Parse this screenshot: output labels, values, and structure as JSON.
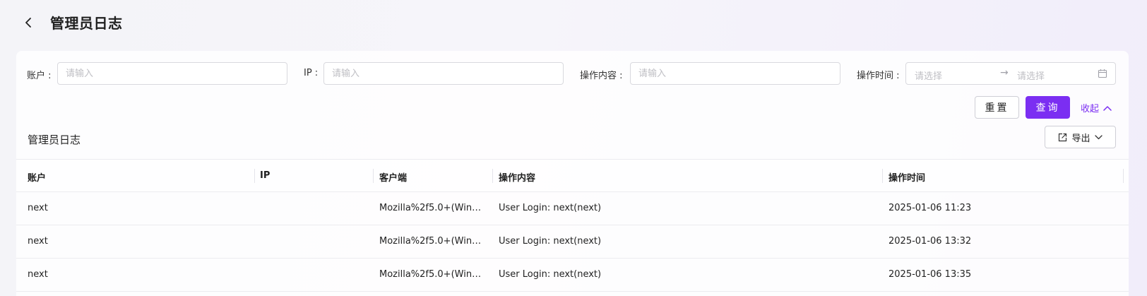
{
  "header": {
    "title": "管理员日志"
  },
  "filters": {
    "account": {
      "label": "账户 :",
      "placeholder": "请输入",
      "value": ""
    },
    "ip": {
      "label": "IP :",
      "placeholder": "请输入",
      "value": ""
    },
    "content": {
      "label": "操作内容 :",
      "placeholder": "请输入",
      "value": ""
    },
    "time": {
      "label": "操作时间 :",
      "start_placeholder": "请选择",
      "end_placeholder": "请选择",
      "arrow": "→"
    }
  },
  "actions": {
    "reset": "重置",
    "query": "查询",
    "collapse": "收起"
  },
  "section": {
    "title": "管理员日志",
    "export": "导出"
  },
  "table": {
    "columns": [
      "账户",
      "IP",
      "客户端",
      "操作内容",
      "操作时间"
    ],
    "rows": [
      {
        "account": "next",
        "ip": "",
        "client": "Mozilla%2f5.0+(Wind…",
        "content": "User Login: next(next)",
        "time": "2025-01-06 11:23"
      },
      {
        "account": "next",
        "ip": "",
        "client": "Mozilla%2f5.0+(Wind…",
        "content": "User Login: next(next)",
        "time": "2025-01-06 13:32"
      },
      {
        "account": "next",
        "ip": "",
        "client": "Mozilla%2f5.0+(Wind…",
        "content": "User Login: next(next)",
        "time": "2025-01-06 13:35"
      }
    ]
  },
  "colors": {
    "accent": "#7b2ef2",
    "border": "#d9d9de",
    "placeholder": "#bfbfc4"
  },
  "icons": {
    "back": "chevron-left-icon",
    "calendar": "calendar-icon",
    "export": "external-link-icon",
    "collapse": "chevron-up-icon",
    "dropdown": "chevron-down-icon"
  }
}
